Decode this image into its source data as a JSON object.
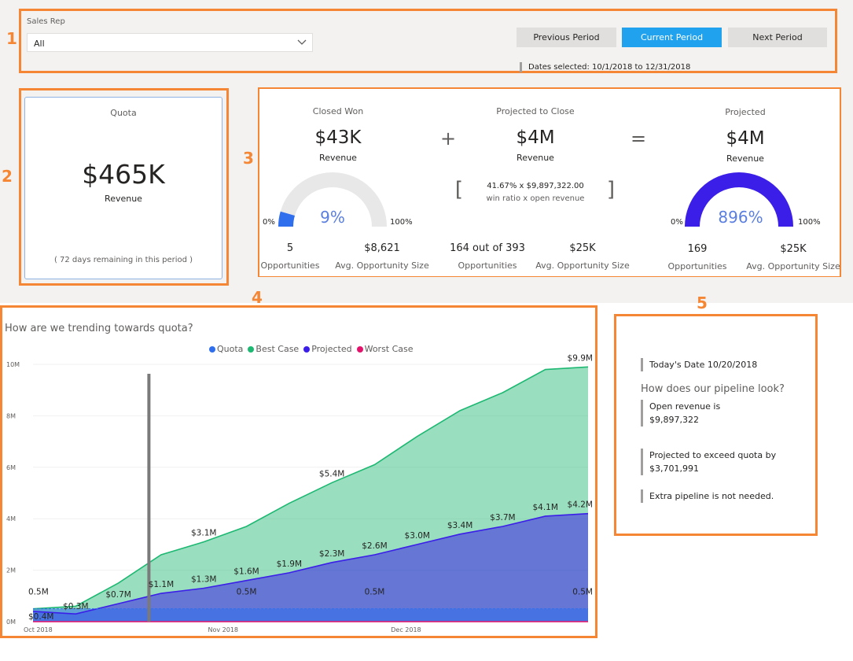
{
  "callouts": [
    "1",
    "2",
    "3",
    "4",
    "5"
  ],
  "slicer": {
    "label": "Sales Rep",
    "value": "All"
  },
  "period_buttons": {
    "previous": "Previous Period",
    "current": "Current Period",
    "next": "Next Period"
  },
  "dates_selected": "Dates selected: 10/1/2018 to 12/31/2018",
  "quota_card": {
    "title": "Quota",
    "value": "$465K",
    "subtitle": "Revenue",
    "remaining": "( 72 days remaining in this period )"
  },
  "kpis": {
    "closed_won": {
      "title": "Closed Won",
      "value": "$43K",
      "subtitle": "Revenue",
      "gauge": {
        "min": "0%",
        "max": "100%",
        "label": "9%",
        "fraction": 0.09,
        "color": "#2f6fed"
      },
      "opportunities": "5",
      "opportunities_label": "Opportunities",
      "avg_size": "$8,621",
      "avg_size_label": "Avg. Opportunity Size"
    },
    "plus_sign": "+",
    "projected_to_close": {
      "title": "Projected to Close",
      "value": "$4M",
      "subtitle": "Revenue",
      "bracket_left": "[",
      "bracket_right": "]",
      "formula": "41.67% x $9,897,322.00",
      "formula_sub": "win ratio x open revenue",
      "opportunities": "164 out of 393",
      "opportunities_label": "Opportunities",
      "avg_size": "$25K",
      "avg_size_label": "Avg. Opportunity Size"
    },
    "equals_sign": "=",
    "projected": {
      "title": "Projected",
      "value": "$4M",
      "subtitle": "Revenue",
      "gauge": {
        "min": "0%",
        "max": "100%",
        "label": "896%",
        "fraction": 1.0,
        "color": "#3b1fe8"
      },
      "opportunities": "169",
      "opportunities_label": "Opportunities",
      "avg_size": "$25K",
      "avg_size_label": "Avg. Opportunity Size"
    }
  },
  "chart_data": {
    "type": "area",
    "title": "How are we trending towards quota?",
    "legend_placement": "top-center",
    "x": [
      "2018-10-01",
      "2018-10-08",
      "2018-10-15",
      "2018-10-22",
      "2018-10-29",
      "2018-11-05",
      "2018-11-12",
      "2018-11-19",
      "2018-11-26",
      "2018-12-03",
      "2018-12-10",
      "2018-12-17",
      "2018-12-24",
      "2018-12-31"
    ],
    "x_ticks": [
      "Oct 2018",
      "Nov 2018",
      "Dec 2018"
    ],
    "y_ticks": [
      "0M",
      "2M",
      "4M",
      "6M",
      "8M",
      "10M"
    ],
    "ylim": [
      0,
      10
    ],
    "y_unit": "M",
    "marker_date": "2018-10-20",
    "series": [
      {
        "name": "Quota",
        "color": "#2f6fed",
        "values": [
          0.5,
          0.5,
          0.5,
          0.5,
          0.5,
          0.5,
          0.5,
          0.5,
          0.5,
          0.5,
          0.5,
          0.5,
          0.5,
          0.5
        ]
      },
      {
        "name": "Best Case",
        "color": "#1db872",
        "values": [
          0.5,
          0.6,
          1.5,
          2.6,
          3.1,
          3.7,
          4.6,
          5.4,
          6.1,
          7.2,
          8.2,
          8.9,
          9.8,
          9.9
        ]
      },
      {
        "name": "Projected",
        "color": "#3b1fe8",
        "values": [
          0.4,
          0.3,
          0.7,
          1.1,
          1.3,
          1.6,
          1.9,
          2.3,
          2.6,
          3.0,
          3.4,
          3.7,
          4.1,
          4.2
        ]
      },
      {
        "name": "Worst Case",
        "color": "#e3136b",
        "values": [
          0,
          0,
          0,
          0,
          0,
          0,
          0,
          0,
          0,
          0,
          0,
          0,
          0,
          0
        ]
      }
    ],
    "data_labels": [
      {
        "series": "Quota",
        "index": 0,
        "text": "0.5M"
      },
      {
        "series": "Quota",
        "index": 5,
        "text": "0.5M"
      },
      {
        "series": "Quota",
        "index": 8,
        "text": "0.5M"
      },
      {
        "series": "Quota",
        "index": 13,
        "text": "0.5M"
      },
      {
        "series": "Best Case",
        "index": 4,
        "text": "$3.1M"
      },
      {
        "series": "Best Case",
        "index": 7,
        "text": "$5.4M"
      },
      {
        "series": "Best Case",
        "index": 13,
        "text": "$9.9M"
      },
      {
        "series": "Projected",
        "index": 0,
        "text": "$0.4M"
      },
      {
        "series": "Projected",
        "index": 1,
        "text": "$0.3M"
      },
      {
        "series": "Projected",
        "index": 2,
        "text": "$0.7M"
      },
      {
        "series": "Projected",
        "index": 3,
        "text": "$1.1M"
      },
      {
        "series": "Projected",
        "index": 4,
        "text": "$1.3M"
      },
      {
        "series": "Projected",
        "index": 5,
        "text": "$1.6M"
      },
      {
        "series": "Projected",
        "index": 6,
        "text": "$1.9M"
      },
      {
        "series": "Projected",
        "index": 7,
        "text": "$2.3M"
      },
      {
        "series": "Projected",
        "index": 8,
        "text": "$2.6M"
      },
      {
        "series": "Projected",
        "index": 9,
        "text": "$3.0M"
      },
      {
        "series": "Projected",
        "index": 10,
        "text": "$3.4M"
      },
      {
        "series": "Projected",
        "index": 11,
        "text": "$3.7M"
      },
      {
        "series": "Projected",
        "index": 12,
        "text": "$4.1M"
      },
      {
        "series": "Projected",
        "index": 13,
        "text": "$4.2M"
      }
    ]
  },
  "insights": {
    "today": "Today's Date 10/20/2018",
    "question": "How does our pipeline look?",
    "open_revenue_label": "Open revenue is",
    "open_revenue_value": "$9,897,322",
    "exceed_label": "Projected to exceed quota by",
    "exceed_value": "$3,701,991",
    "extra": "Extra pipeline is not needed."
  },
  "colors": {
    "accent": "#20a2ee",
    "callout": "#f58634"
  }
}
